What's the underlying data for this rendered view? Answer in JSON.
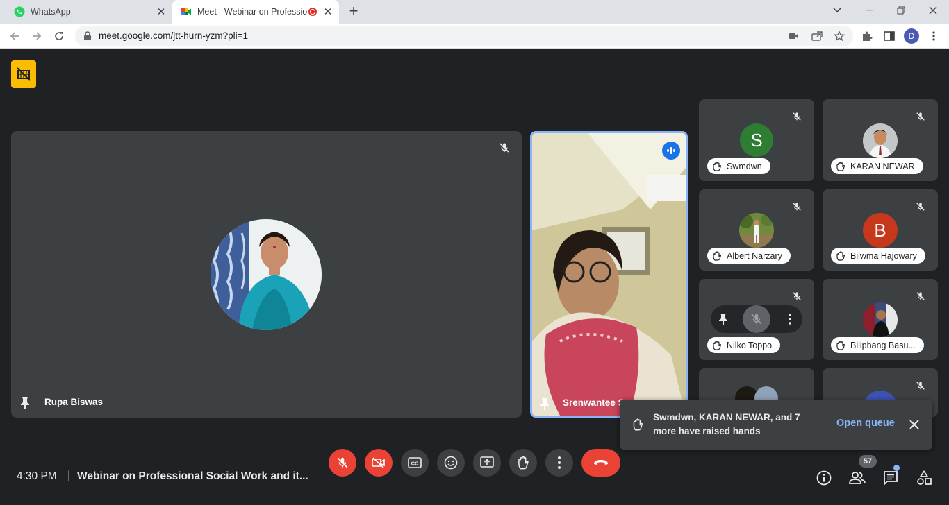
{
  "browser": {
    "tabs": [
      {
        "label": "WhatsApp",
        "active": false
      },
      {
        "label": "Meet - Webinar on Professio",
        "active": true
      }
    ],
    "url": "meet.google.com/jtt-hurn-yzm?pli=1",
    "profile_initial": "D"
  },
  "meeting": {
    "time": "4:30 PM",
    "separator": "|",
    "title": "Webinar on Professional Social Work and it...",
    "participant_count": "57",
    "main_tile_name": "Rupa Biswas",
    "speaker_tile_name": "Srenwantee S",
    "grid": [
      {
        "name": "Swmdwn",
        "initial": "S",
        "color": "#2e7d32"
      },
      {
        "name": "KARAN NEWAR",
        "initial": "",
        "color": ""
      },
      {
        "name": "Albert Narzary",
        "initial": "",
        "color": ""
      },
      {
        "name": "Bilwma Hajowary",
        "initial": "B",
        "color": "#c5381c"
      },
      {
        "name": "Nilko Toppo",
        "initial": "",
        "color": ""
      },
      {
        "name": "Biliphang Basu...",
        "initial": "",
        "color": ""
      }
    ],
    "toast": {
      "message": "Swmdwn, KARAN NEWAR, and 7 more have raised hands",
      "action": "Open queue"
    }
  },
  "colors": {
    "accent_red": "#ea4335",
    "accent_blue": "#8ab4f8",
    "speaker_border": "#8ab4f8"
  }
}
